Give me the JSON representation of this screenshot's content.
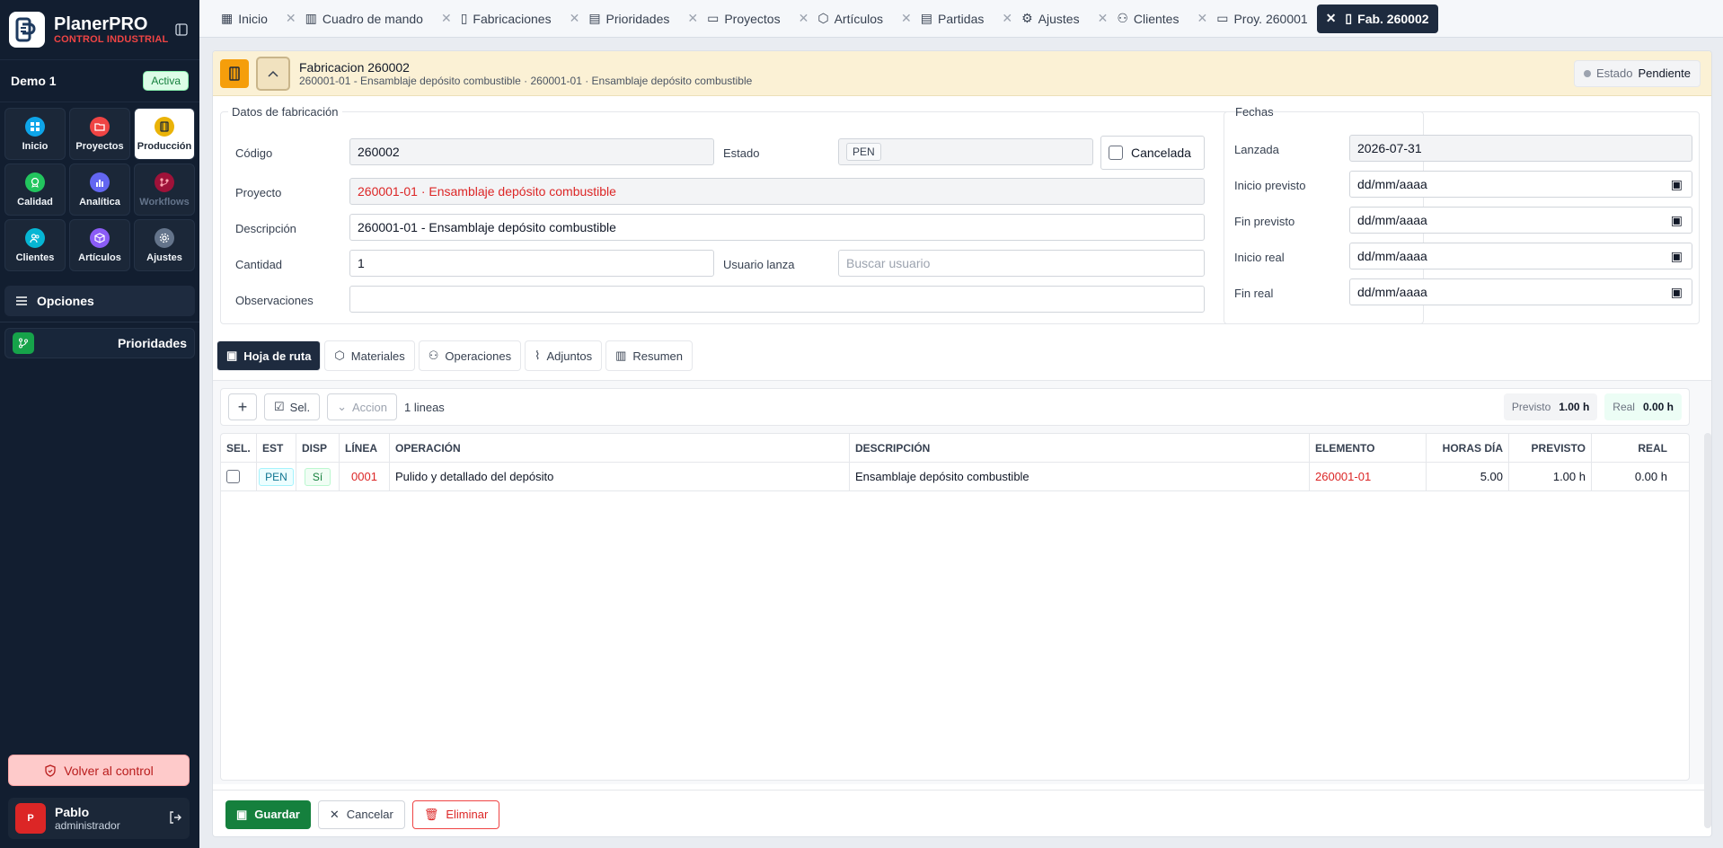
{
  "brand": {
    "title": "PlanerPRO",
    "subtitle": "CONTROL INDUSTRIAL"
  },
  "company": {
    "name": "Demo 1",
    "status": "Activa"
  },
  "modules": [
    {
      "label": "Inicio",
      "icon": "grid-icon",
      "color": "#0ea5e9"
    },
    {
      "label": "Proyectos",
      "icon": "folder-icon",
      "color": "#ef4444"
    },
    {
      "label": "Producción",
      "icon": "film-icon",
      "color": "#eab308"
    },
    {
      "label": "Calidad",
      "icon": "badge-icon",
      "color": "#22c55e"
    },
    {
      "label": "Analítica",
      "icon": "chart-icon",
      "color": "#6366f1"
    },
    {
      "label": "Workflows",
      "icon": "flow-icon",
      "color": "#be123c"
    },
    {
      "label": "Clientes",
      "icon": "users-icon",
      "color": "#06b6d4"
    },
    {
      "label": "Artículos",
      "icon": "box-icon",
      "color": "#8b5cf6"
    },
    {
      "label": "Ajustes",
      "icon": "gear-icon",
      "color": "#64748b"
    }
  ],
  "sidebar": {
    "options": "Opciones",
    "priorities": "Prioridades",
    "back": "Volver al control"
  },
  "user": {
    "initial": "P",
    "name": "Pablo",
    "role": "administrador"
  },
  "tabs": [
    {
      "label": "Inicio",
      "icon": "grid-icon"
    },
    {
      "label": "Cuadro de mando",
      "icon": "chart-icon"
    },
    {
      "label": "Fabricaciones",
      "icon": "film-icon"
    },
    {
      "label": "Prioridades",
      "icon": "doc-icon"
    },
    {
      "label": "Proyectos",
      "icon": "folder-icon"
    },
    {
      "label": "Artículos",
      "icon": "box-icon"
    },
    {
      "label": "Partidas",
      "icon": "doc-icon"
    },
    {
      "label": "Ajustes",
      "icon": "gear-icon"
    },
    {
      "label": "Clientes",
      "icon": "users-icon"
    },
    {
      "label": "Proy. 260001",
      "icon": "folder-icon"
    },
    {
      "label": "Fab. 260002",
      "icon": "film-icon"
    }
  ],
  "record": {
    "title": "Fabricacion 260002",
    "subtitle": "260001-01 - Ensamblaje depósito combustible · 260001-01 · Ensamblaje depósito combustible",
    "estado_label": "Estado",
    "estado_value": "Pendiente"
  },
  "form": {
    "legend": "Datos de fabricación",
    "codigo_label": "Código",
    "codigo": "260002",
    "estado_label": "Estado",
    "estado": "PEN",
    "cancelada_label": "Cancelada",
    "proyecto_label": "Proyecto",
    "proyecto": "260001-01 · Ensamblaje depósito combustible",
    "descripcion_label": "Descripción",
    "descripcion": "260001-01 - Ensamblaje depósito combustible",
    "cantidad_label": "Cantidad",
    "cantidad": "1",
    "usuario_label": "Usuario lanza",
    "usuario_placeholder": "Buscar usuario",
    "observaciones_label": "Observaciones",
    "observaciones": ""
  },
  "dates": {
    "legend": "Fechas",
    "lanzada_label": "Lanzada",
    "lanzada": "2026-07-31",
    "inicio_prev_label": "Inicio previsto",
    "fin_prev_label": "Fin previsto",
    "inicio_real_label": "Inicio real",
    "fin_real_label": "Fin real",
    "placeholder": "dd/mm/aaaa"
  },
  "subtabs": [
    {
      "label": "Hoja de ruta",
      "icon": "calendar-icon"
    },
    {
      "label": "Materiales",
      "icon": "box-icon"
    },
    {
      "label": "Operaciones",
      "icon": "users-icon"
    },
    {
      "label": "Adjuntos",
      "icon": "paperclip-icon"
    },
    {
      "label": "Resumen",
      "icon": "chart-icon"
    }
  ],
  "toolbar": {
    "add": "+",
    "select": "Sel.",
    "action": "Accion",
    "count": "1 lineas",
    "previsto_label": "Previsto",
    "previsto": "1.00 h",
    "real_label": "Real",
    "real": "0.00 h"
  },
  "table": {
    "headers": [
      "SEL.",
      "EST",
      "DISP",
      "LÍNEA",
      "OPERACIÓN",
      "DESCRIPCIÓN",
      "ELEMENTO",
      "HORAS DÍA",
      "PREVISTO",
      "REAL"
    ],
    "rows": [
      {
        "est": "PEN",
        "disp": "Sí",
        "linea": "0001",
        "operacion": "Pulido y detallado del depósito",
        "descripcion": "Ensamblaje depósito combustible",
        "elemento": "260001-01",
        "horas_dia": "5.00",
        "previsto": "1.00 h",
        "real": "0.00 h"
      }
    ]
  },
  "footer": {
    "save": "Guardar",
    "cancel": "Cancelar",
    "delete": "Eliminar"
  }
}
